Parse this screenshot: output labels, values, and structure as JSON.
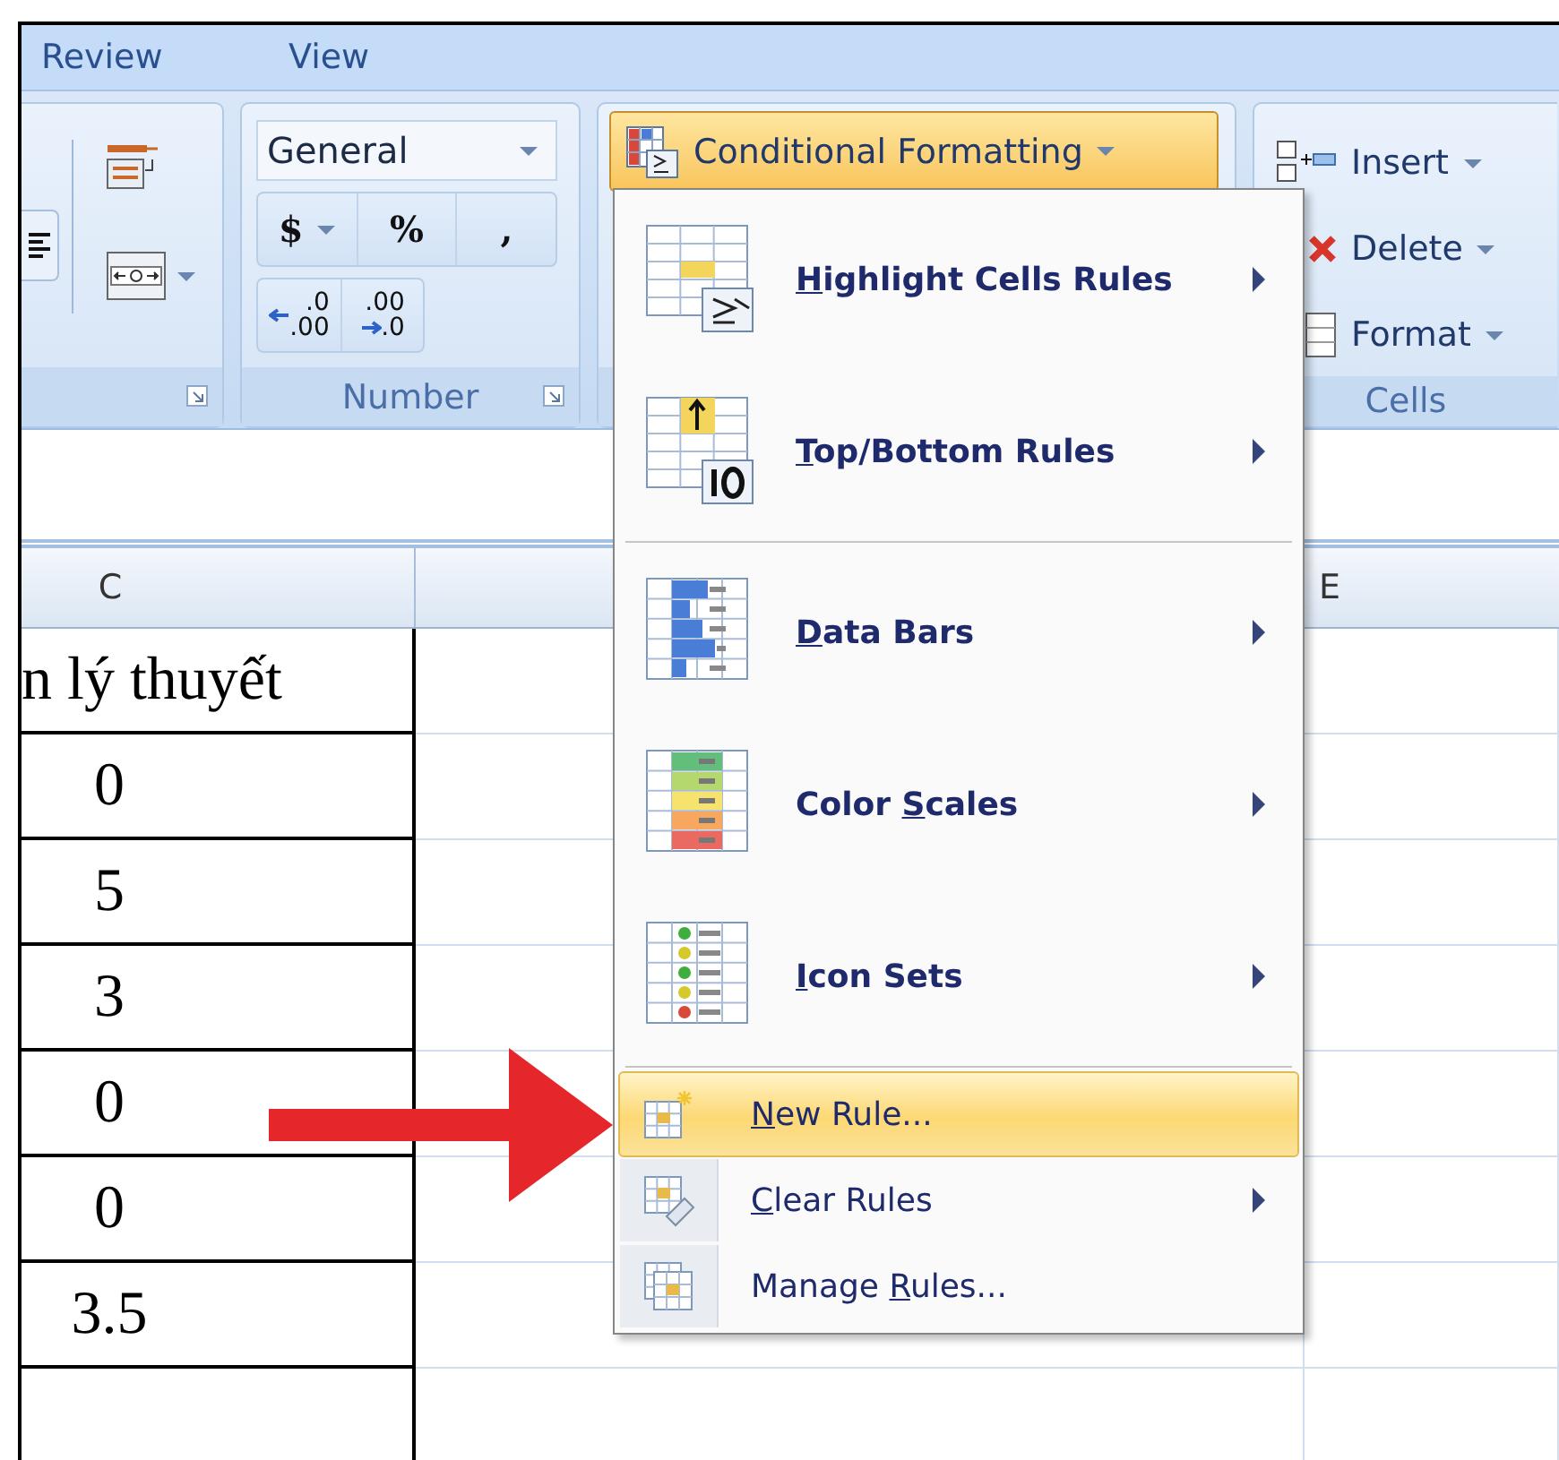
{
  "tabs": [
    {
      "label": "Review",
      "selected": false
    },
    {
      "label": "View",
      "selected": false
    }
  ],
  "ribbon": {
    "number_group": {
      "format": "General",
      "buttons": [
        {
          "label": "$",
          "dropdown": true
        },
        {
          "label": "%",
          "dropdown": false
        },
        {
          "label": ",",
          "dropdown": false
        }
      ],
      "decimal_buttons": [
        {
          "kind": "increase",
          "top": ".0",
          "bottom": ".00"
        },
        {
          "kind": "decrease",
          "top": ".00",
          "bottom": ".0"
        }
      ],
      "label": "Number"
    },
    "conditional_formatting": {
      "label": "Conditional Formatting",
      "open": true
    },
    "cells_group": {
      "buttons": [
        {
          "kind": "insert",
          "label": "Insert"
        },
        {
          "kind": "delete",
          "label": "Delete"
        },
        {
          "kind": "format",
          "label": "Format"
        }
      ],
      "label": "Cells"
    }
  },
  "sheet": {
    "columns": [
      "C",
      "E"
    ],
    "rows": [
      {
        "kind": "text",
        "value": "n lý thuyết"
      },
      {
        "kind": "number",
        "value": "0"
      },
      {
        "kind": "number",
        "value": "5"
      },
      {
        "kind": "number",
        "value": "3"
      },
      {
        "kind": "number",
        "value": "0"
      },
      {
        "kind": "number",
        "value": "0"
      },
      {
        "kind": "number",
        "value": "3.5"
      }
    ]
  },
  "menu": {
    "items": [
      {
        "kind": "highlight",
        "key": "H",
        "after": "ighlight Cells Rules",
        "submenu": true,
        "selected": false,
        "separator_before": false
      },
      {
        "kind": "topbottom",
        "key": "T",
        "after": "op/Bottom Rules",
        "submenu": true,
        "selected": false,
        "separator_before": false
      },
      {
        "kind": "databars",
        "key": "D",
        "after": "ata Bars",
        "submenu": true,
        "selected": false,
        "separator_before": true
      },
      {
        "kind": "colorscales",
        "before": "Color ",
        "key": "S",
        "after": "cales",
        "submenu": true,
        "selected": false,
        "separator_before": false
      },
      {
        "kind": "iconsets",
        "key": "I",
        "after": "con Sets",
        "submenu": true,
        "selected": false,
        "separator_before": false
      },
      {
        "kind": "new",
        "key": "N",
        "after": "ew Rule...",
        "submenu": false,
        "selected": true,
        "separator_before": true
      },
      {
        "kind": "clear",
        "key": "C",
        "after": "lear Rules",
        "submenu": true,
        "selected": false,
        "separator_before": false
      },
      {
        "kind": "manage",
        "before": "Manage ",
        "key": "R",
        "after": "ules...",
        "submenu": false,
        "selected": false,
        "separator_before": false
      }
    ]
  }
}
